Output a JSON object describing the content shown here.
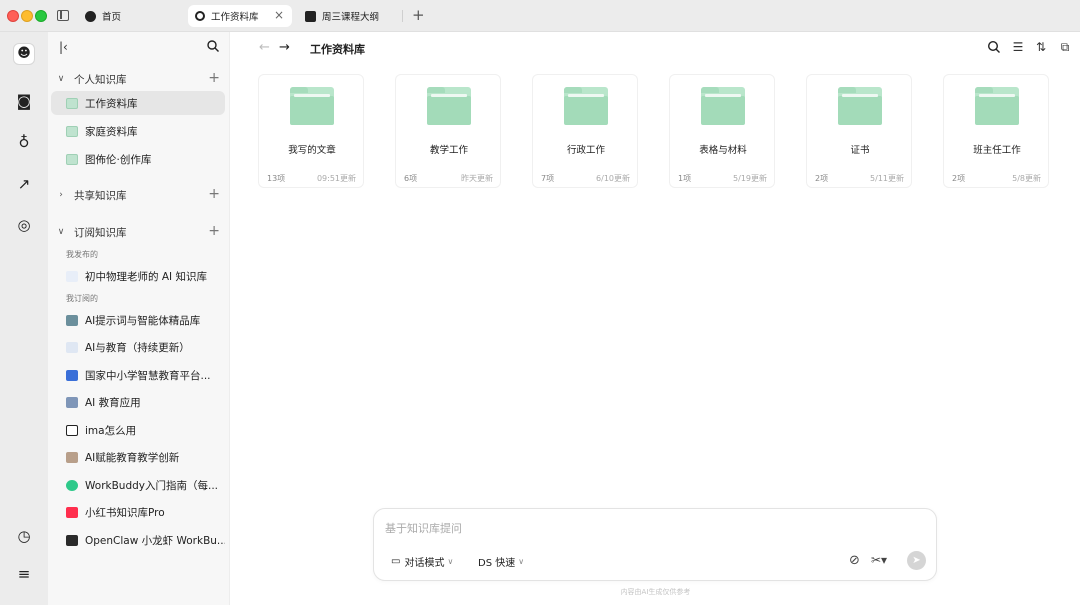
{
  "tabs": [
    {
      "label": "首页",
      "icon": "home-icon"
    },
    {
      "label": "工作资料库",
      "icon": "lightbulb-icon"
    },
    {
      "label": "周三课程大纲",
      "icon": "note-icon"
    }
  ],
  "sidebar": {
    "sections": {
      "personal": {
        "title": "个人知识库",
        "items": [
          "工作资料库",
          "家庭资料库",
          "图佈伦·创作库"
        ]
      },
      "shared": {
        "title": "共享知识库"
      },
      "subscribed": {
        "title": "订阅知识库",
        "published_label": "我发布的",
        "published_items": [
          "初中物理老师的 AI 知识库"
        ],
        "subscribed_label": "我订阅的",
        "subscribed_items": [
          "AI提示词与智能体精品库",
          "AI与教育（持续更新）",
          "国家中小学智慧教育平台...",
          "AI 教育应用",
          "ima怎么用",
          "AI赋能教育教学创新",
          "WorkBuddy入门指南（每...",
          "小红书知识库Pro",
          "OpenClaw 小龙虾 WorkBu..."
        ]
      }
    }
  },
  "main": {
    "breadcrumb": "工作资料库",
    "folders": [
      {
        "name": "我写的文章",
        "count": "13项",
        "updated": "09:51更新"
      },
      {
        "name": "教学工作",
        "count": "6项",
        "updated": "昨天更新"
      },
      {
        "name": "行政工作",
        "count": "7项",
        "updated": "6/10更新"
      },
      {
        "name": "表格与材料",
        "count": "1项",
        "updated": "5/19更新"
      },
      {
        "name": "证书",
        "count": "2项",
        "updated": "5/11更新"
      },
      {
        "name": "班主任工作",
        "count": "2项",
        "updated": "5/8更新"
      }
    ]
  },
  "chat": {
    "placeholder": "基于知识库提问",
    "mode_label": "对话模式",
    "model_label": "DS 快速",
    "disclaimer": "内容由AI生成仅供参考"
  },
  "colors": {
    "folder": "#a3dbb9",
    "selected_item": "#e6e6e6",
    "titlebar": "#ececec"
  }
}
